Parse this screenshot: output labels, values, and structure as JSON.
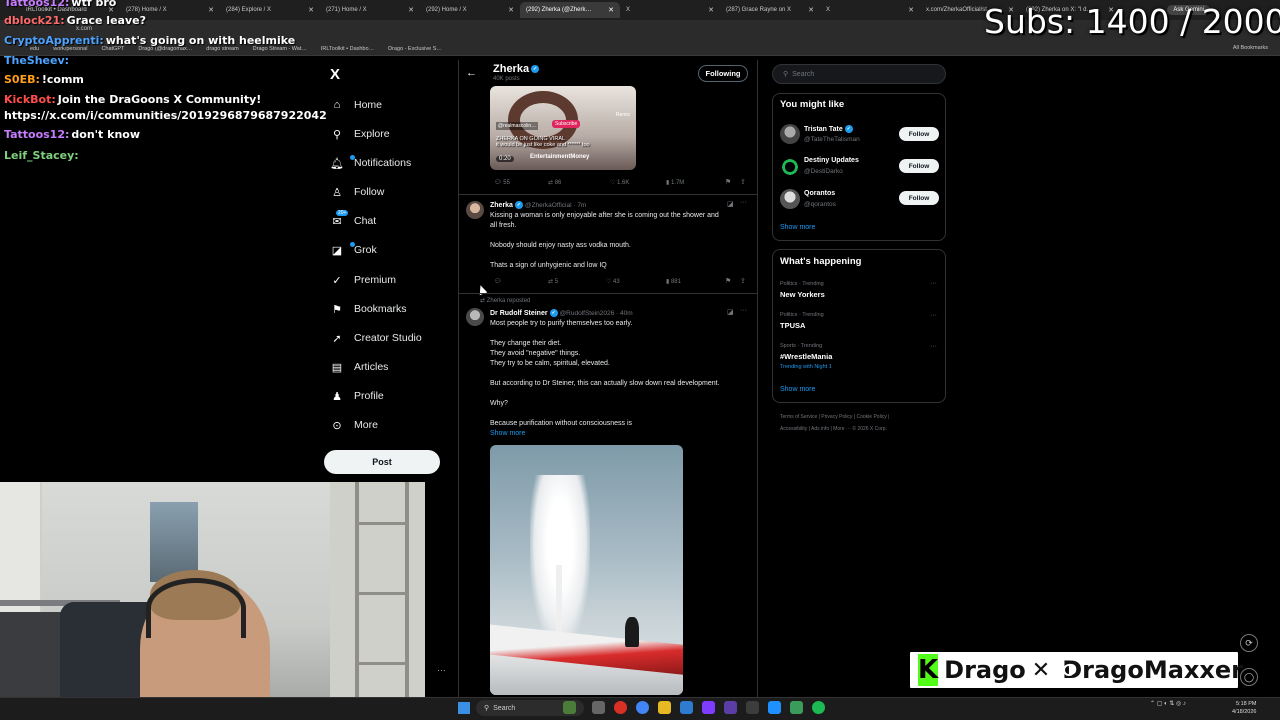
{
  "browser": {
    "tabs": [
      {
        "label": "IRLToolkit • Dashboard",
        "active": false
      },
      {
        "label": "(278) Home / X",
        "active": false
      },
      {
        "label": "(284) Explore / X",
        "active": false
      },
      {
        "label": "(271) Home / X",
        "active": false
      },
      {
        "label": "(292) Home / X",
        "active": false
      },
      {
        "label": "(292) Zherka (@Zherk…",
        "active": true
      },
      {
        "label": "X",
        "active": false
      },
      {
        "label": "(287) Grace Rayne on X",
        "active": false
      },
      {
        "label": "X",
        "active": false
      },
      {
        "label": "x.com/ZherkaOfficial/st…",
        "active": false
      },
      {
        "label": "(292) Zherka on X: \"I d…",
        "active": false
      }
    ],
    "url": "x.com",
    "gemini_label": "Ask Gemini",
    "bookmarks": [
      "edu",
      "work/personal",
      "ChatGPT",
      "Drago (@dragomax…",
      "drago stream",
      "Drago Stream - Wat…",
      "IRLToolkit • Dashbo…",
      "Drago - Exclusive S…"
    ],
    "all_bookmarks": "All Bookmarks"
  },
  "overlay": {
    "subs": "Subs: 1400 / 2000",
    "chat": [
      {
        "name": "Tattoos12:",
        "text": "wtf bro",
        "color": "#c77dff"
      },
      {
        "name": "dblock21:",
        "text": "Grace leave?",
        "color": "#ff6b6b"
      },
      {
        "name": "CryptoApprenti:",
        "text": "what's going on with heelmike",
        "color": "#4da3ff"
      },
      {
        "name": "TheSheev:",
        "text": "",
        "color": "#4da3ff"
      },
      {
        "name": "S0EB:",
        "text": "!comm",
        "color": "#ff9f1c"
      },
      {
        "name": "KickBot:",
        "text": "Join the DraGoons X Community!",
        "color": "#ff4d4d"
      },
      {
        "name": "",
        "text": "https://x.com/i/communities/2019296879687922042",
        "color": "#ffffff"
      },
      {
        "name": "Tattoos12:",
        "text": "don't know",
        "color": "#c77dff"
      },
      {
        "name": "Leif_Stacey:",
        "text": "",
        "color": "#7fd17f"
      }
    ],
    "brand": {
      "left": "Drago",
      "right": "DragoMaxxer",
      "kick_letter": "K"
    }
  },
  "nav": {
    "logo": "X",
    "items": [
      {
        "label": "Home",
        "icon": "home-icon",
        "glyph": "⌂"
      },
      {
        "label": "Explore",
        "icon": "search-icon",
        "glyph": "⚲"
      },
      {
        "label": "Notifications",
        "icon": "bell-icon",
        "glyph": "🔔︎"
      },
      {
        "label": "Follow",
        "icon": "person-icon",
        "glyph": "♙"
      },
      {
        "label": "Chat",
        "icon": "chat-icon",
        "glyph": "✉"
      },
      {
        "label": "Grok",
        "icon": "grok-icon",
        "glyph": "◪"
      },
      {
        "label": "Premium",
        "icon": "premium-icon",
        "glyph": "✓"
      },
      {
        "label": "Bookmarks",
        "icon": "bookmark-icon",
        "glyph": "⚑"
      },
      {
        "label": "Creator Studio",
        "icon": "rocket-icon",
        "glyph": "➚"
      },
      {
        "label": "Articles",
        "icon": "article-icon",
        "glyph": "▤"
      },
      {
        "label": "Profile",
        "icon": "profile-icon",
        "glyph": "♟"
      },
      {
        "label": "More",
        "icon": "more-icon",
        "glyph": "⊙"
      }
    ],
    "chat_badge": "20+",
    "post_label": "Post"
  },
  "feed": {
    "title": "Zherka",
    "subtitle": "40K posts",
    "following_label": "Following",
    "video": {
      "name_tag": "@realmascolin…",
      "subscribe": "Subscribe",
      "caption": "ZHERKA ON GOING VIRAL",
      "caption2": "it would be just like coke and ****** too",
      "time": "0:20",
      "brand": "EntertainmentMoney",
      "side": "Remix"
    },
    "video_actions": {
      "replies": "55",
      "reposts": "86",
      "likes": "1.6K",
      "views": "1.7M"
    },
    "tweet1": {
      "name": "Zherka",
      "handle": "@ZherkaOfficial · 7m",
      "lines": [
        "Kissing a woman is only enjoyable after she is coming out the shower and",
        "all fresh.",
        "Nobody should enjoy nasty ass vodka mouth.",
        "Thats a sign of unhygienic and low IQ"
      ],
      "actions": {
        "reposts": "5",
        "likes": "43",
        "views": "881"
      }
    },
    "repost_label": "Zherka reposted",
    "tweet2": {
      "name": "Dr Rudolf Steiner",
      "handle": "@RudolfStein2026 · 40m",
      "lines": [
        "Most people try to purify themselves too early.",
        "They change their diet.",
        "They avoid \"negative\" things.",
        "They try to be calm, spiritual, elevated.",
        "But according to Dr Steiner, this can actually slow down real development.",
        "Why?",
        "Because purification without consciousness is"
      ],
      "show_more": "Show more"
    }
  },
  "right": {
    "search_placeholder": "Search",
    "suggest_title": "You might like",
    "suggestions": [
      {
        "name": "Tristan Tate",
        "handle": "@TateTheTalisman",
        "button": "Follow"
      },
      {
        "name": "Destiny Updates",
        "handle": "@DestiDarko",
        "button": "Follow"
      },
      {
        "name": "Qorantos",
        "handle": "@qorantos",
        "button": "Follow"
      }
    ],
    "show_more": "Show more",
    "happening_title": "What's happening",
    "trends": [
      {
        "meta": "Politics · Trending",
        "name": "New Yorkers",
        "extra": ""
      },
      {
        "meta": "Politics · Trending",
        "name": "TPUSA",
        "extra": ""
      },
      {
        "meta": "Sports · Trending",
        "name": "#WrestleMania",
        "extra": "Trending with Night 1"
      }
    ],
    "footer1": "Terms of Service  |  Privacy Policy  |  Cookie Policy  |",
    "footer2": "Accessibility  |  Ads info  |  More ···  © 2026 X Corp."
  },
  "taskbar": {
    "search": "Search",
    "time": "5:18 PM",
    "date": "4/18/2026"
  }
}
